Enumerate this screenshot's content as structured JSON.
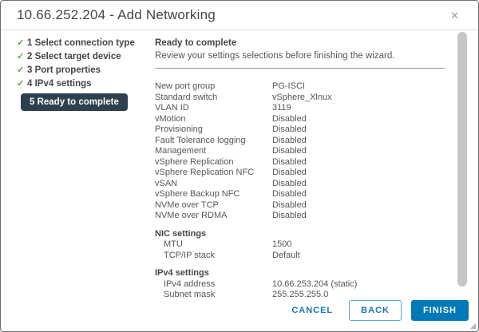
{
  "dialog": {
    "title": "10.66.252.204 - Add Networking"
  },
  "icons": {
    "close": "✕",
    "check": "✓"
  },
  "colors": {
    "accent_blue": "#0079b8",
    "success_green": "#55a532",
    "active_step_bg": "#2d404e"
  },
  "steps": [
    {
      "number": "1",
      "label": "Select connection type",
      "completed": true,
      "active": false
    },
    {
      "number": "2",
      "label": "Select target device",
      "completed": true,
      "active": false
    },
    {
      "number": "3",
      "label": "Port properties",
      "completed": true,
      "active": false
    },
    {
      "number": "4",
      "label": "IPv4 settings",
      "completed": true,
      "active": false
    },
    {
      "number": "5",
      "label": "Ready to complete",
      "completed": false,
      "active": true
    }
  ],
  "content": {
    "heading": "Ready to complete",
    "subtitle": "Review your settings selections before finishing the wizard.",
    "settings": [
      {
        "label": "New port group",
        "value": "PG-ISCI"
      },
      {
        "label": "Standard switch",
        "value": "vSphere_Xlnux"
      },
      {
        "label": "VLAN ID",
        "value": "3119"
      },
      {
        "label": "vMotion",
        "value": "Disabled"
      },
      {
        "label": "Provisioning",
        "value": "Disabled"
      },
      {
        "label": "Fault Tolerance logging",
        "value": "Disabled"
      },
      {
        "label": "Management",
        "value": "Disabled"
      },
      {
        "label": "vSphere Replication",
        "value": "Disabled"
      },
      {
        "label": "vSphere Replication NFC",
        "value": "Disabled"
      },
      {
        "label": "vSAN",
        "value": "Disabled"
      },
      {
        "label": "vSphere Backup NFC",
        "value": "Disabled"
      },
      {
        "label": "NVMe over TCP",
        "value": "Disabled"
      },
      {
        "label": "NVMe over RDMA",
        "value": "Disabled"
      }
    ],
    "sections": [
      {
        "title": "NIC settings",
        "rows": [
          {
            "label": "MTU",
            "value": "1500"
          },
          {
            "label": "TCP/IP stack",
            "value": "Default"
          }
        ]
      },
      {
        "title": "IPv4 settings",
        "rows": [
          {
            "label": "IPv4 address",
            "value": "10.66.253.204 (static)"
          },
          {
            "label": "Subnet mask",
            "value": "255.255.255.0"
          }
        ]
      }
    ]
  },
  "footer": {
    "cancel_label": "CANCEL",
    "back_label": "BACK",
    "finish_label": "FINISH"
  }
}
